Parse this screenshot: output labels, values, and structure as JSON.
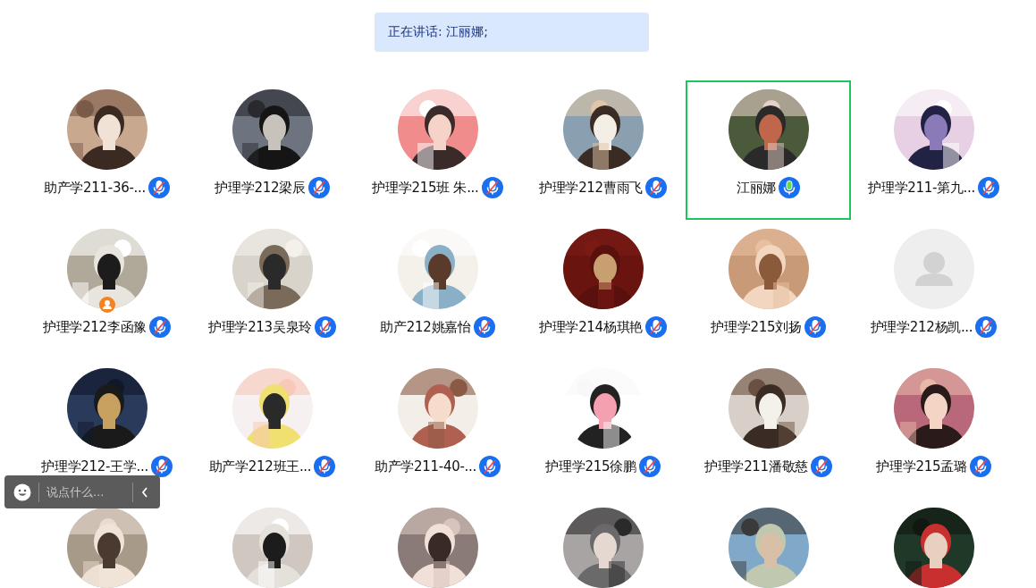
{
  "speaking_banner": {
    "text": "正在讲话: 江丽娜;"
  },
  "participants": [
    {
      "name": "助产学211-36-...",
      "muted": true,
      "speaking": false,
      "host": false,
      "avatar": {
        "kind": "picture"
      }
    },
    {
      "name": "护理学212梁辰",
      "muted": true,
      "speaking": false,
      "host": false,
      "avatar": {
        "kind": "picture"
      }
    },
    {
      "name": "护理学215班 朱...",
      "muted": true,
      "speaking": false,
      "host": false,
      "avatar": {
        "kind": "picture"
      }
    },
    {
      "name": "护理学212曹雨飞",
      "muted": true,
      "speaking": false,
      "host": false,
      "avatar": {
        "kind": "picture"
      }
    },
    {
      "name": "江丽娜",
      "muted": false,
      "speaking": true,
      "host": false,
      "avatar": {
        "kind": "picture"
      }
    },
    {
      "name": "护理学211-第九...",
      "muted": true,
      "speaking": false,
      "host": false,
      "avatar": {
        "kind": "picture"
      }
    },
    {
      "name": "护理学212李函豫",
      "muted": true,
      "speaking": false,
      "host": true,
      "avatar": {
        "kind": "picture"
      }
    },
    {
      "name": "护理学213吴泉玲",
      "muted": true,
      "speaking": false,
      "host": false,
      "avatar": {
        "kind": "picture"
      }
    },
    {
      "name": "助产212姚嘉怡",
      "muted": true,
      "speaking": false,
      "host": false,
      "avatar": {
        "kind": "picture"
      }
    },
    {
      "name": "护理学214杨琪艳",
      "muted": true,
      "speaking": false,
      "host": false,
      "avatar": {
        "kind": "picture"
      }
    },
    {
      "name": "护理学215刘扬",
      "muted": true,
      "speaking": false,
      "host": false,
      "avatar": {
        "kind": "picture"
      }
    },
    {
      "name": "护理学212杨凯...",
      "muted": true,
      "speaking": false,
      "host": false,
      "avatar": {
        "kind": "default"
      }
    },
    {
      "name": "护理学212-王学...",
      "muted": true,
      "speaking": false,
      "host": false,
      "avatar": {
        "kind": "picture"
      }
    },
    {
      "name": "助产学212班王...",
      "muted": true,
      "speaking": false,
      "host": false,
      "avatar": {
        "kind": "picture"
      }
    },
    {
      "name": "助产学211-40-...",
      "muted": true,
      "speaking": false,
      "host": false,
      "avatar": {
        "kind": "picture"
      }
    },
    {
      "name": "护理学215徐鹏",
      "muted": true,
      "speaking": false,
      "host": false,
      "avatar": {
        "kind": "picture"
      }
    },
    {
      "name": "护理学211潘敬慈",
      "muted": true,
      "speaking": false,
      "host": false,
      "avatar": {
        "kind": "picture"
      }
    },
    {
      "name": "护理学215孟璐",
      "muted": true,
      "speaking": false,
      "host": false,
      "avatar": {
        "kind": "picture"
      }
    },
    {
      "avatar": {
        "kind": "picture"
      }
    },
    {
      "avatar": {
        "kind": "picture"
      }
    },
    {
      "avatar": {
        "kind": "picture"
      }
    },
    {
      "avatar": {
        "kind": "picture"
      }
    },
    {
      "avatar": {
        "kind": "picture"
      }
    },
    {
      "avatar": {
        "kind": "picture"
      }
    }
  ],
  "chat_bar": {
    "placeholder": "说点什么..."
  }
}
